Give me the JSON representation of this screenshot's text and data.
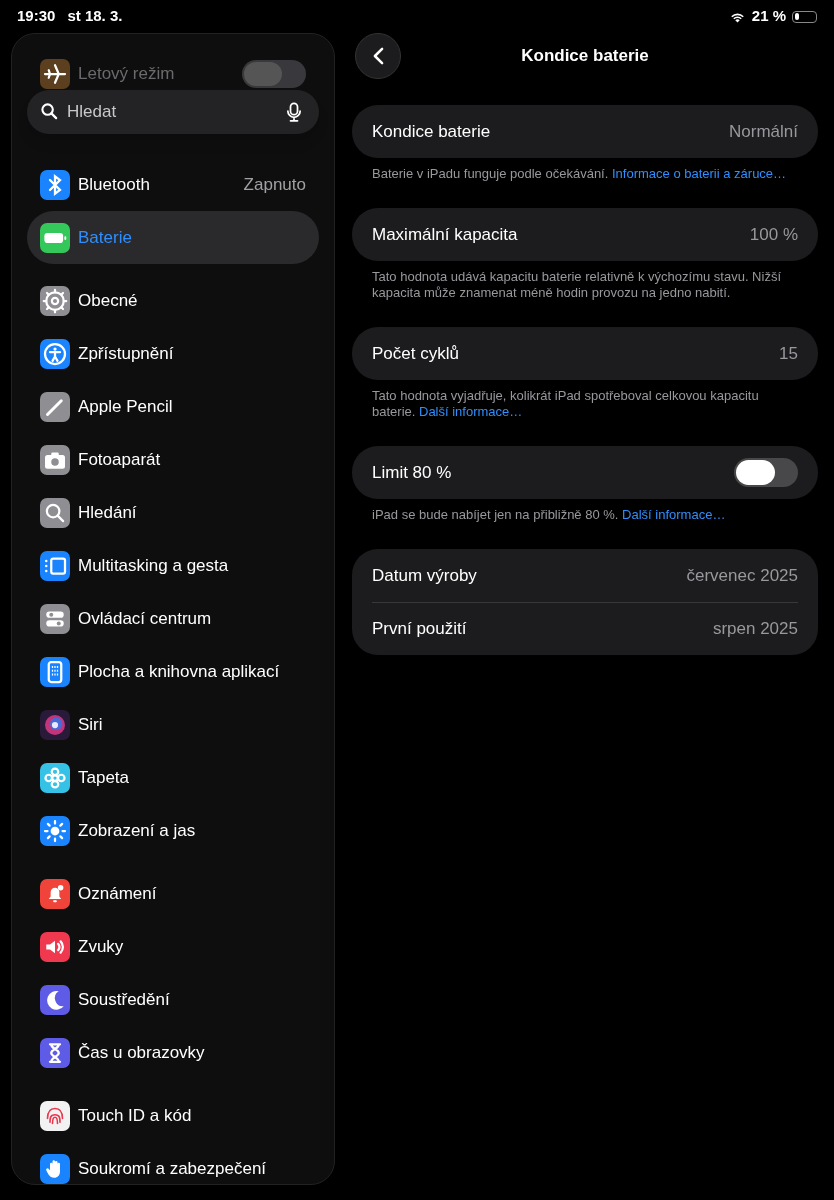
{
  "status_bar": {
    "time": "19:30",
    "date": "st 18. 3.",
    "battery_text": "21 %"
  },
  "sidebar": {
    "search": {
      "placeholder": "Hledat"
    },
    "groups": [
      [
        {
          "label": "Letový režim",
          "color": "#5c3f1e",
          "kind": "toggle",
          "on": false,
          "faded": true,
          "selected": false
        },
        {
          "label": "Bluetooth",
          "color": "#1a84ff",
          "kind": "value",
          "value": "Zapnuto",
          "faded": false,
          "selected": false
        },
        {
          "label": "Baterie",
          "color": "#34c759",
          "kind": "plain",
          "faded": false,
          "selected": true
        }
      ],
      [
        {
          "label": "Obecné",
          "color": "#8e8e93",
          "kind": "plain",
          "faded": false,
          "selected": false
        },
        {
          "label": "Zpřístupnění",
          "color": "#1a84ff",
          "kind": "plain",
          "faded": false,
          "selected": false
        },
        {
          "label": "Apple Pencil",
          "color": "#8e8e93",
          "kind": "plain",
          "faded": false,
          "selected": false
        },
        {
          "label": "Fotoaparát",
          "color": "#8e8e93",
          "kind": "plain",
          "faded": false,
          "selected": false
        },
        {
          "label": "Hledání",
          "color": "#8e8e93",
          "kind": "plain",
          "faded": false,
          "selected": false
        },
        {
          "label": "Multitasking a gesta",
          "color": "#1a84ff",
          "kind": "plain",
          "faded": false,
          "selected": false
        },
        {
          "label": "Ovládací centrum",
          "color": "#8e8e93",
          "kind": "plain",
          "faded": false,
          "selected": false
        },
        {
          "label": "Plocha a knihovna aplikací",
          "color": "#1a84ff",
          "kind": "plain",
          "faded": false,
          "selected": false
        },
        {
          "label": "Siri",
          "color": "#2a1a3a",
          "kind": "plain",
          "faded": false,
          "selected": false
        },
        {
          "label": "Tapeta",
          "color": "#35c2e6",
          "kind": "plain",
          "faded": false,
          "selected": false
        },
        {
          "label": "Zobrazení a jas",
          "color": "#1a84ff",
          "kind": "plain",
          "faded": false,
          "selected": false
        }
      ],
      [
        {
          "label": "Oznámení",
          "color": "#f0443a",
          "kind": "plain",
          "faded": false,
          "selected": false
        },
        {
          "label": "Zvuky",
          "color": "#f0384f",
          "kind": "plain",
          "faded": false,
          "selected": false
        },
        {
          "label": "Soustředění",
          "color": "#5e5ce6",
          "kind": "plain",
          "faded": false,
          "selected": false
        },
        {
          "label": "Čas u obrazovky",
          "color": "#5e5ce6",
          "kind": "plain",
          "faded": false,
          "selected": false
        }
      ],
      [
        {
          "label": "Touch ID a kód",
          "color": "#f2f2f2",
          "kind": "plain",
          "faded": false,
          "selected": false
        },
        {
          "label": "Soukromí a zabezpečení",
          "color": "#1a84ff",
          "kind": "plain",
          "faded": false,
          "selected": false
        }
      ]
    ]
  },
  "detail": {
    "title": "Kondice baterie",
    "sections": [
      {
        "rows": [
          {
            "kind": "value",
            "label": "Kondice baterie",
            "value": "Normální"
          }
        ],
        "footer": {
          "text": "Baterie v iPadu funguje podle očekávání.",
          "link": "Informace o baterii a záruce…"
        }
      },
      {
        "rows": [
          {
            "kind": "value",
            "label": "Maximální kapacita",
            "value": "100 %"
          }
        ],
        "footer": {
          "text": "Tato hodnota udává kapacitu baterie relativně k výchozímu stavu. Nižší kapacita může znamenat méně hodin provozu na jedno nabití."
        }
      },
      {
        "rows": [
          {
            "kind": "value",
            "label": "Počet cyklů",
            "value": "15"
          }
        ],
        "footer": {
          "text": "Tato hodnota vyjadřuje, kolikrát iPad spotřeboval celkovou kapacitu baterie.",
          "link": "Další informace…"
        }
      },
      {
        "rows": [
          {
            "kind": "toggle",
            "label": "Limit 80 %",
            "on": false
          }
        ],
        "footer": {
          "text": "iPad se bude nabíjet jen na přibližně 80 %.",
          "link": "Další informace…"
        }
      },
      {
        "rows": [
          {
            "kind": "value",
            "label": "Datum výroby",
            "value": "červenec 2025"
          },
          {
            "kind": "value",
            "label": "První použití",
            "value": "srpen 2025"
          }
        ]
      }
    ]
  }
}
